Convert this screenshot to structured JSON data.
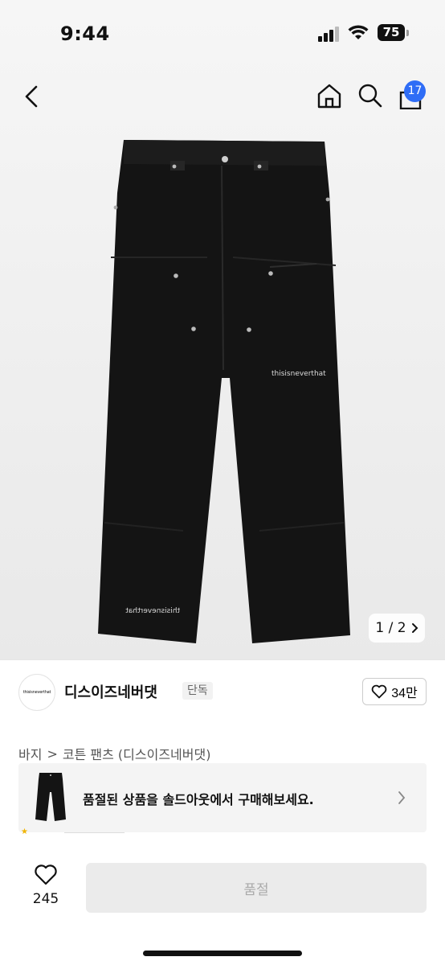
{
  "status_bar": {
    "time": "9:44",
    "battery": "75"
  },
  "nav": {
    "cart_count": "17",
    "icons": [
      "back-icon",
      "home-icon",
      "search-icon",
      "bag-icon"
    ]
  },
  "gallery": {
    "pager": "1 / 2",
    "logo_print_left": "thisisneverthat",
    "logo_print_right": "thisisneverthat"
  },
  "brand": {
    "logo_text": "thisisneverthat",
    "name": "디스이즈네버댓",
    "tag": "단독",
    "likes": "34만"
  },
  "breadcrumb": {
    "category": "바지",
    "separator": ">",
    "subcategory": "코튼 팬츠 (디스이즈네버댓)"
  },
  "soldout_banner": {
    "text": "품절된 상품을 솔드아웃에서 구매해보세요."
  },
  "bottom_bar": {
    "like_count": "245",
    "cta_label": "품절"
  },
  "colors": {
    "accent": "#2f6df6",
    "pants": "#141414",
    "banner_bg": "#f4f4f4",
    "cta_bg": "#ebebeb"
  }
}
